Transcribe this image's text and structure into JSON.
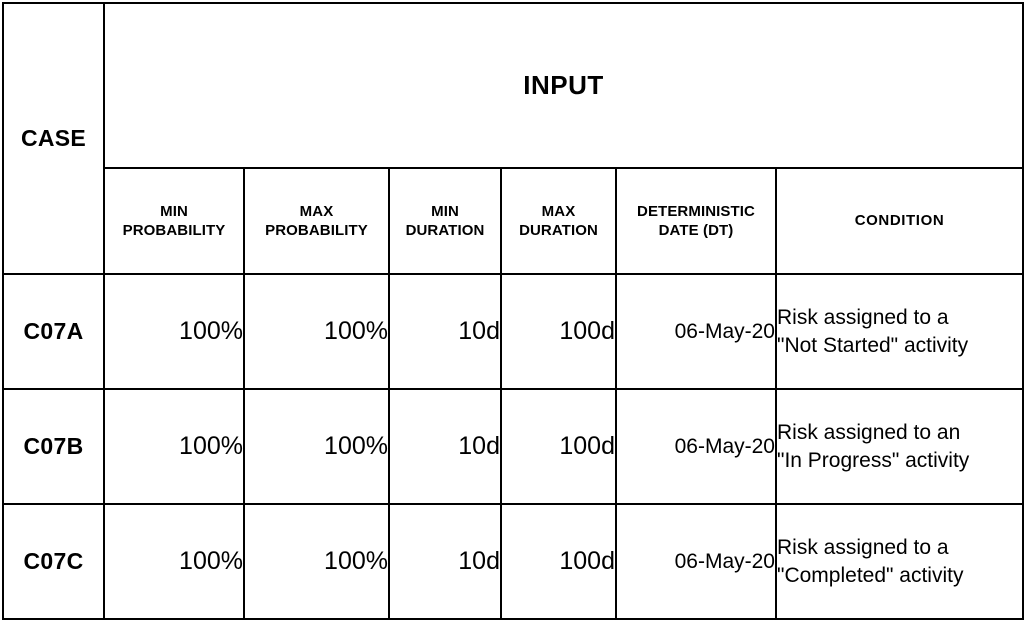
{
  "table": {
    "corner_label": "CASE",
    "group_header": "INPUT",
    "columns": [
      {
        "key": "case",
        "label": "CASE"
      },
      {
        "key": "min_probability",
        "line1": "MIN",
        "line2": "PROBABILITY"
      },
      {
        "key": "max_probability",
        "line1": "MAX",
        "line2": "PROBABILITY"
      },
      {
        "key": "min_duration",
        "line1": "MIN",
        "line2": "DURATION"
      },
      {
        "key": "max_duration",
        "line1": "MAX",
        "line2": "DURATION"
      },
      {
        "key": "deterministic_date",
        "line1": "DETERMINISTIC",
        "line2": "DATE (DT)"
      },
      {
        "key": "condition",
        "line1": "CONDITION",
        "line2": ""
      }
    ],
    "rows": [
      {
        "case": "C07A",
        "min_probability": "100%",
        "max_probability": "100%",
        "min_duration": "10d",
        "max_duration": "100d",
        "deterministic_date": "06-May-20",
        "condition_line1": "Risk assigned to a",
        "condition_line2": "\"Not Started\" activity"
      },
      {
        "case": "C07B",
        "min_probability": "100%",
        "max_probability": "100%",
        "min_duration": "10d",
        "max_duration": "100d",
        "deterministic_date": "06-May-20",
        "condition_line1": "Risk assigned to an",
        "condition_line2": "\"In Progress\" activity"
      },
      {
        "case": "C07C",
        "min_probability": "100%",
        "max_probability": "100%",
        "min_duration": "10d",
        "max_duration": "100d",
        "deterministic_date": "06-May-20",
        "condition_line1": "Risk assigned to a",
        "condition_line2": "\"Completed\" activity"
      }
    ],
    "colors": {
      "header_blue": "#daeaf1",
      "corner_gray": "#c1c1c1",
      "border": "#000000",
      "body_background": "#ffffff",
      "text": "#000000"
    }
  }
}
